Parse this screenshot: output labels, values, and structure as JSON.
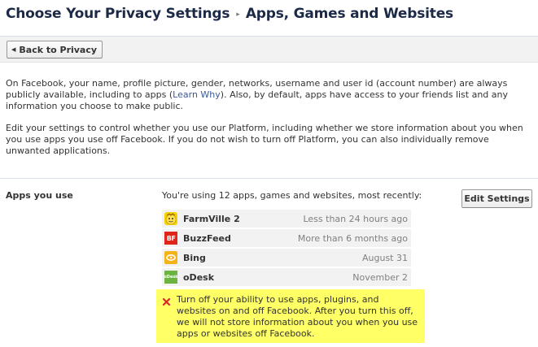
{
  "header": {
    "crumb_primary": "Choose Your Privacy Settings",
    "crumb_separator": "▸",
    "crumb_current": "Apps, Games and Websites"
  },
  "toolbar": {
    "back_label": "Back to Privacy",
    "back_icon": "arrow-left-icon"
  },
  "intro": {
    "p1_before_link": "On Facebook, your name, profile picture, gender, networks, username and user id (account number) are always publicly available, including to apps (",
    "p1_link": "Learn Why",
    "p1_after_link": "). Also, by default, apps have access to your friends list and any information you choose to make public.",
    "p2": "Edit your settings to control whether you use our Platform, including whether we store information about you when you use apps you use off Facebook. If you do not wish to turn off Platform, you can also individually remove unwanted applications."
  },
  "apps_section": {
    "label": "Apps you use",
    "summary": "You're using 12 apps, games and websites, most recently:",
    "edit_button": "Edit Settings",
    "apps": [
      {
        "name": "FarmVille 2",
        "time": "Less than 24 hours ago",
        "icon": "farmville-icon"
      },
      {
        "name": "BuzzFeed",
        "time": "More than 6 months ago",
        "icon": "buzzfeed-icon",
        "icon_text": "BF"
      },
      {
        "name": "Bing",
        "time": "August 31",
        "icon": "bing-icon"
      },
      {
        "name": "oDesk",
        "time": "November 2",
        "icon": "odesk-icon",
        "icon_text": "oDesk"
      }
    ],
    "turn_off_text": "Turn off your ability to use apps, plugins, and websites on and off Facebook. After you turn this off, we will not store information about you when you use apps or websites off Facebook."
  },
  "colors": {
    "title": "#1c2a47",
    "link": "#3b5998",
    "highlight": "#ffff66",
    "row_bg": "#f2f2f2",
    "muted": "#808080",
    "danger": "#e0242c"
  }
}
